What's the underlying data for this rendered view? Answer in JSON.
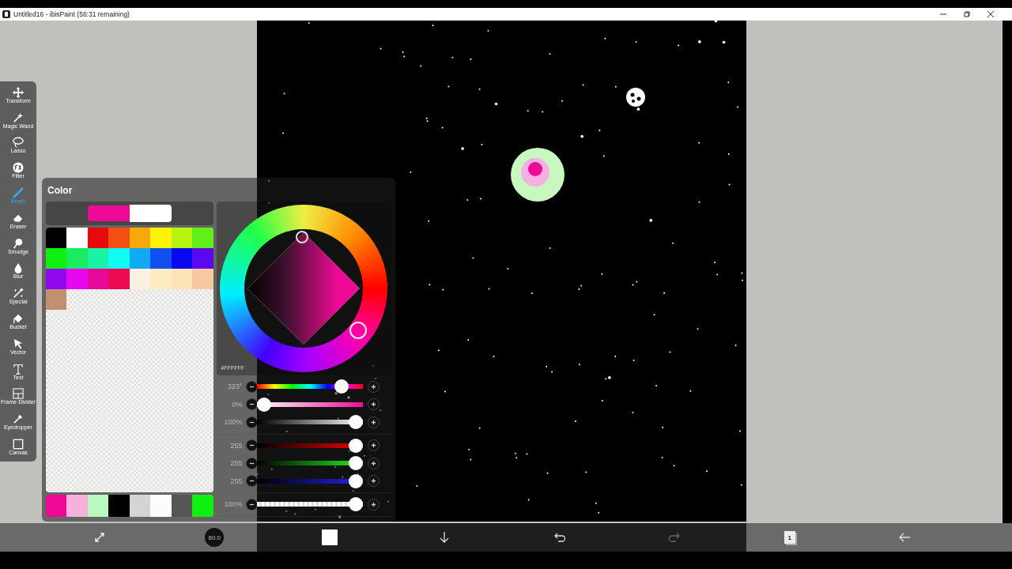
{
  "window": {
    "title": "Untitled16 - ibisPaint (56:31 remaining)"
  },
  "tools": [
    {
      "label": "Transform",
      "selected": false
    },
    {
      "label": "Magic Wand",
      "selected": false
    },
    {
      "label": "Lasso",
      "selected": false
    },
    {
      "label": "Filter",
      "selected": false
    },
    {
      "label": "Brush",
      "selected": true
    },
    {
      "label": "Eraser",
      "selected": false
    },
    {
      "label": "Smudge",
      "selected": false
    },
    {
      "label": "Blur",
      "selected": false
    },
    {
      "label": "Special",
      "selected": false
    },
    {
      "label": "Bucket",
      "selected": false
    },
    {
      "label": "Vector",
      "selected": false
    },
    {
      "label": "Text",
      "selected": false
    },
    {
      "label": "Frame Divider",
      "selected": false
    },
    {
      "label": "Eyedropper",
      "selected": false
    },
    {
      "label": "Canvas",
      "selected": false
    }
  ],
  "color_panel": {
    "title": "Color",
    "current_colors": [
      {
        "color": "#ee0a94",
        "selected": false
      },
      {
        "color": "#ffffff",
        "selected": true
      }
    ],
    "palette": [
      {
        "color": "#000000"
      },
      {
        "color": "#ffffff"
      },
      {
        "color": "#e80a0a"
      },
      {
        "color": "#f05010"
      },
      {
        "color": "#f8a808"
      },
      {
        "color": "#fef208"
      },
      {
        "color": "#b8f410"
      },
      {
        "color": "#60f018"
      },
      {
        "color": "#10f010"
      },
      {
        "color": "#18ec60"
      },
      {
        "color": "#18f4a4"
      },
      {
        "color": "#10fcf4"
      },
      {
        "color": "#10aaf4"
      },
      {
        "color": "#1050f0"
      },
      {
        "color": "#0808f0"
      },
      {
        "color": "#5a08f0"
      },
      {
        "color": "#9008f0"
      },
      {
        "color": "#e808f0"
      },
      {
        "color": "#e8089a"
      },
      {
        "color": "#ee0a50"
      },
      {
        "color": "#fcf0e0"
      },
      {
        "color": "#fcecc0"
      },
      {
        "color": "#fce4b4"
      },
      {
        "color": "#f8c8a0"
      },
      {
        "color": "#c09070"
      }
    ],
    "history": [
      {
        "color": "#ee0a94"
      },
      {
        "color": "#f8b0dc"
      },
      {
        "color": "#b8f8c0"
      },
      {
        "color": "#000000"
      },
      {
        "color": "#d4d4d4"
      },
      {
        "color": "#fcfcfc"
      },
      {
        "color": "#555555"
      },
      {
        "color": "#10f010"
      }
    ],
    "hex": "#FFFFFF",
    "slider_groups": [
      [
        {
          "kind": "hue",
          "reading": "323°",
          "level": 0.85
        },
        {
          "kind": "saturation",
          "reading": "0%",
          "level": 0
        },
        {
          "kind": "brightness",
          "reading": "100%",
          "level": 1
        }
      ],
      [
        {
          "kind": "red",
          "reading": "255",
          "level": 1
        },
        {
          "kind": "green",
          "reading": "255",
          "level": 1
        },
        {
          "kind": "blue",
          "reading": "255",
          "level": 1
        }
      ],
      [
        {
          "kind": "alpha",
          "reading": "100%",
          "level": 1
        }
      ]
    ]
  },
  "bottom_bar": {
    "brush_size": "80.0",
    "layer_count": "1"
  }
}
